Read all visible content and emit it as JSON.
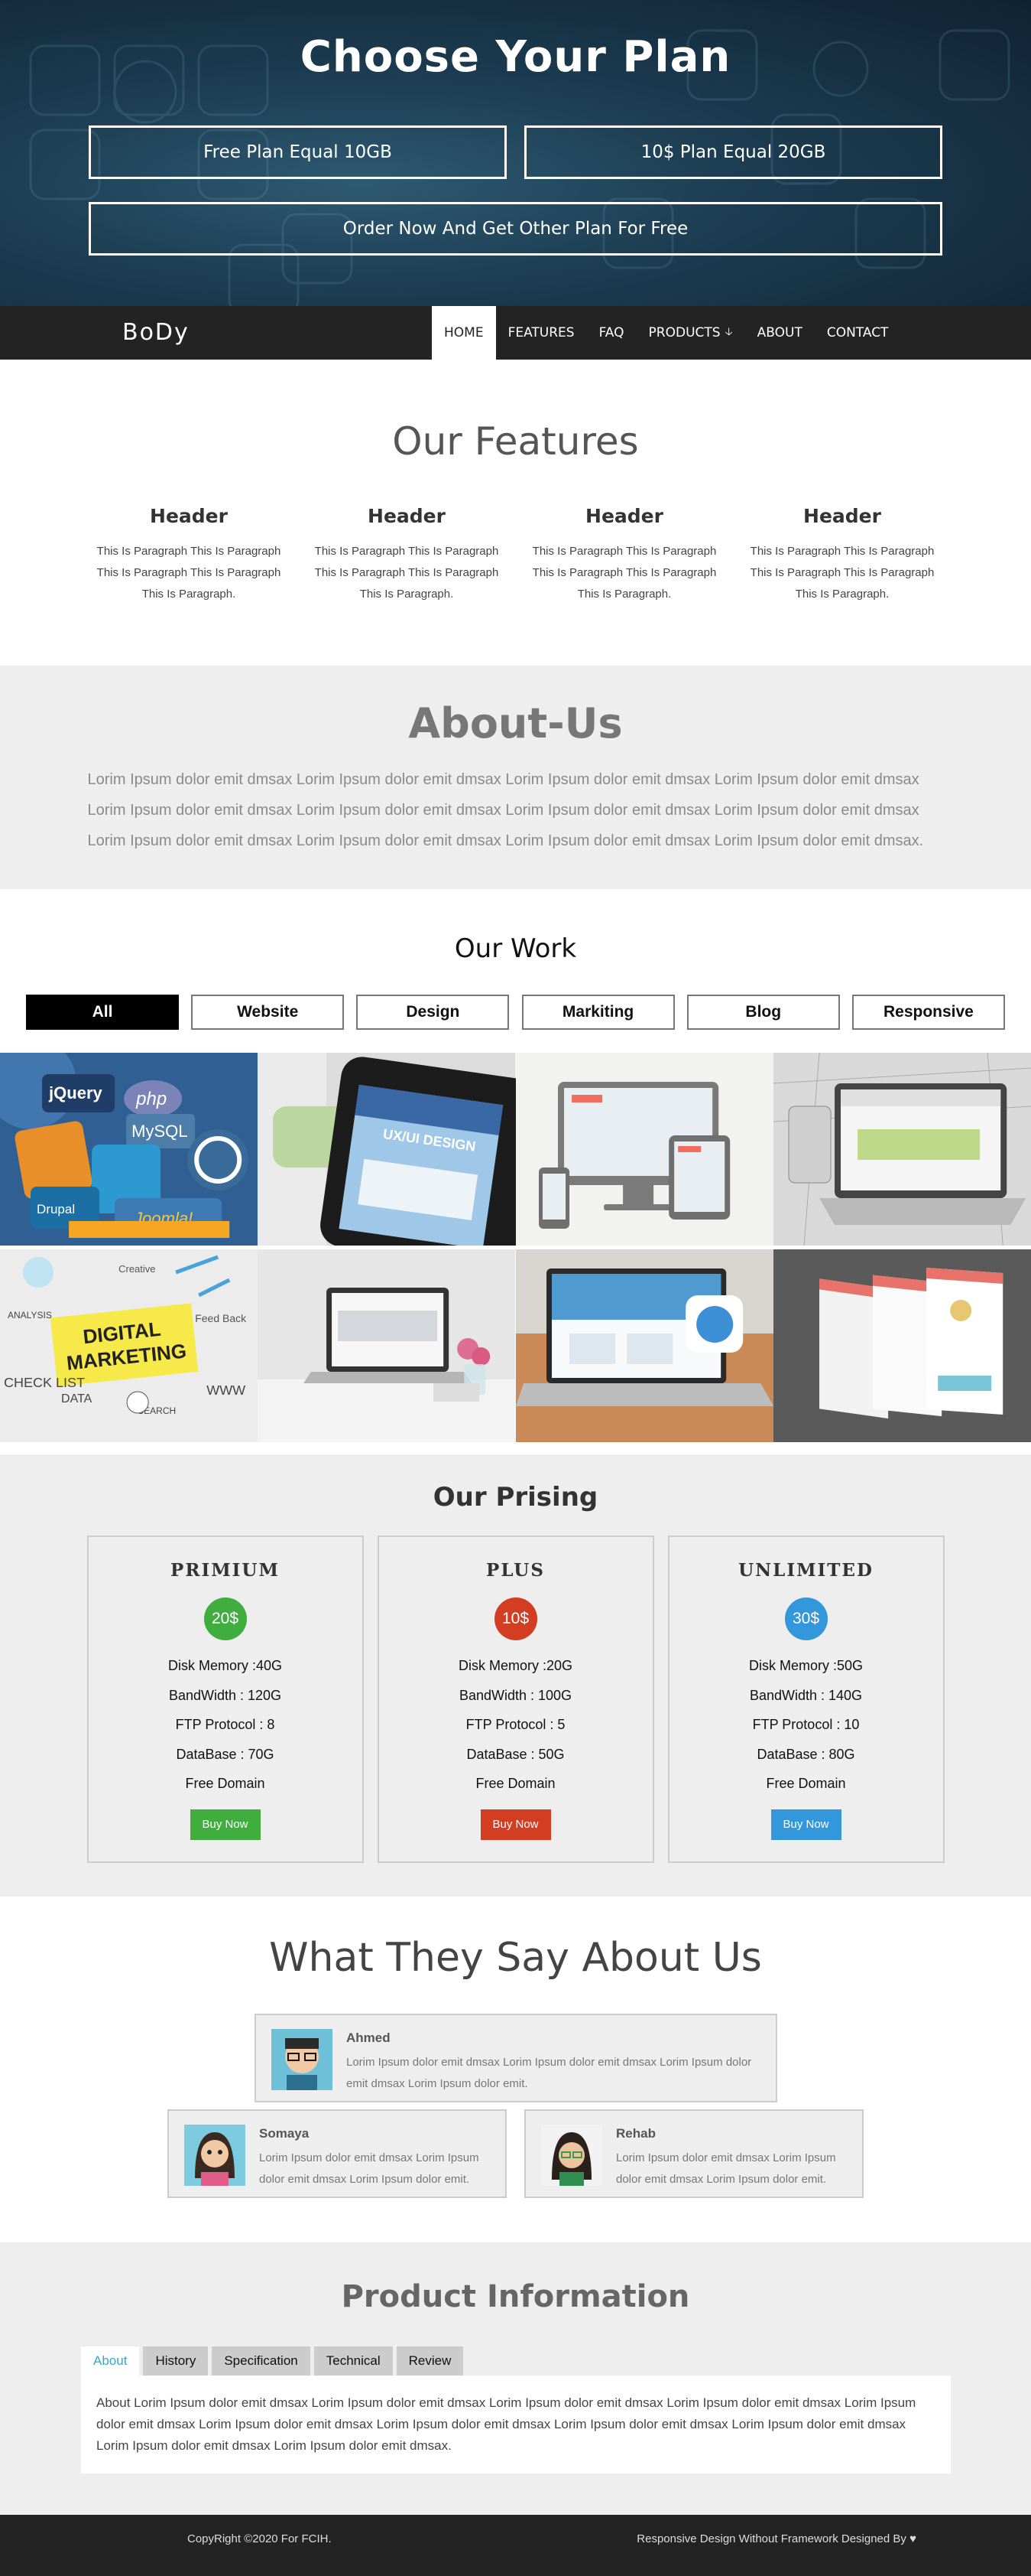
{
  "hero": {
    "title": "Choose Your Plan",
    "plans": [
      "Free Plan Equal 10GB",
      "10$ Plan Equal 20GB",
      "Order Now And Get Other Plan For Free"
    ]
  },
  "nav": {
    "brand": "BoDy",
    "items": [
      "HOME",
      "FEATURES",
      "FAQ",
      "PRODUCTS",
      "ABOUT",
      "CONTACT"
    ],
    "active": "HOME",
    "dropdown_icon": "arrow-down-icon"
  },
  "features": {
    "title": "Our Features",
    "items": [
      {
        "header": "Header",
        "text": "This Is Paragraph This Is Paragraph This Is Paragraph This Is Paragraph This Is Paragraph."
      },
      {
        "header": "Header",
        "text": "This Is Paragraph This Is Paragraph This Is Paragraph This Is Paragraph This Is Paragraph."
      },
      {
        "header": "Header",
        "text": "This Is Paragraph This Is Paragraph This Is Paragraph This Is Paragraph This Is Paragraph."
      },
      {
        "header": "Header",
        "text": "This Is Paragraph This Is Paragraph This Is Paragraph This Is Paragraph This Is Paragraph."
      }
    ]
  },
  "about": {
    "title": "About-Us",
    "text": "Lorim Ipsum dolor emit dmsax Lorim Ipsum dolor emit dmsax Lorim Ipsum dolor emit dmsax Lorim Ipsum dolor emit dmsax Lorim Ipsum dolor emit dmsax Lorim Ipsum dolor emit dmsax Lorim Ipsum dolor emit dmsax Lorim Ipsum dolor emit dmsax Lorim Ipsum dolor emit dmsax Lorim Ipsum dolor emit dmsax Lorim Ipsum dolor emit dmsax Lorim Ipsum dolor emit dmsax."
  },
  "work": {
    "title": "Our Work",
    "filters": [
      "All",
      "Website",
      "Design",
      "Markiting",
      "Blog",
      "Responsive"
    ],
    "active_filter": "All",
    "tiles": [
      {
        "name": "cms-logos-image",
        "ui_text": [
          "php",
          "MySQL",
          "jQuery",
          "Joomla!",
          "Drupal"
        ]
      },
      {
        "name": "ui-ux-phone-image",
        "ui_text": [
          "UX/UI DESIGN"
        ]
      },
      {
        "name": "responsive-devices-image"
      },
      {
        "name": "laptop-sketch-image"
      },
      {
        "name": "digital-marketing-image",
        "ui_text": [
          "DIGITAL",
          "MARKETING",
          "ANALYSIS",
          "CHECK LIST",
          "DATA",
          "WWW",
          "SEARCH",
          "Feed Back",
          "Creative"
        ]
      },
      {
        "name": "laptop-desk-flowers-image"
      },
      {
        "name": "laptop-website-image"
      },
      {
        "name": "app-screens-image"
      }
    ]
  },
  "pricing": {
    "title": "Our Prising",
    "plans": [
      {
        "name": "PRIMIUM",
        "price": "20$",
        "color": "#3fae3f",
        "features": [
          "Disk Memory :40G",
          "BandWidth : 120G",
          "FTP Protocol : 8",
          "DataBase : 70G",
          "Free Domain"
        ],
        "cta": "Buy Now"
      },
      {
        "name": "PLUS",
        "price": "10$",
        "color": "#d33d22",
        "features": [
          "Disk Memory :20G",
          "BandWidth : 100G",
          "FTP Protocol : 5",
          "DataBase : 50G",
          "Free Domain"
        ],
        "cta": "Buy Now"
      },
      {
        "name": "UNLIMITED",
        "price": "30$",
        "color": "#3398db",
        "features": [
          "Disk Memory :50G",
          "BandWidth : 140G",
          "FTP Protocol : 10",
          "DataBase : 80G",
          "Free Domain"
        ],
        "cta": "Buy Now"
      }
    ]
  },
  "testimonials": {
    "title": "What They Say About Us",
    "items": [
      {
        "name": "Ahmed",
        "text": "Lorim Ipsum dolor emit dmsax Lorim Ipsum dolor emit dmsax Lorim Ipsum dolor emit dmsax Lorim Ipsum dolor emit."
      },
      {
        "name": "Somaya",
        "text": "Lorim Ipsum dolor emit dmsax Lorim Ipsum dolor emit dmsax Lorim Ipsum dolor emit."
      },
      {
        "name": "Rehab",
        "text": "Lorim Ipsum dolor emit dmsax Lorim Ipsum dolor emit dmsax Lorim Ipsum dolor emit."
      }
    ]
  },
  "product": {
    "title": "Product Information",
    "tabs": [
      "About",
      "History",
      "Specification",
      "Technical",
      "Review"
    ],
    "active_tab": "About",
    "content": "About Lorim Ipsum dolor emit dmsax Lorim Ipsum dolor emit dmsax Lorim Ipsum dolor emit dmsax Lorim Ipsum dolor emit dmsax Lorim Ipsum dolor emit dmsax Lorim Ipsum dolor emit dmsax Lorim Ipsum dolor emit dmsax Lorim Ipsum dolor emit dmsax Lorim Ipsum dolor emit dmsax Lorim Ipsum dolor emit dmsax Lorim Ipsum dolor emit dmsax."
  },
  "footer": {
    "left": "CopyRight ©2020 For FCIH.",
    "right": "Responsive Design Without Framework Designed By ♥"
  }
}
